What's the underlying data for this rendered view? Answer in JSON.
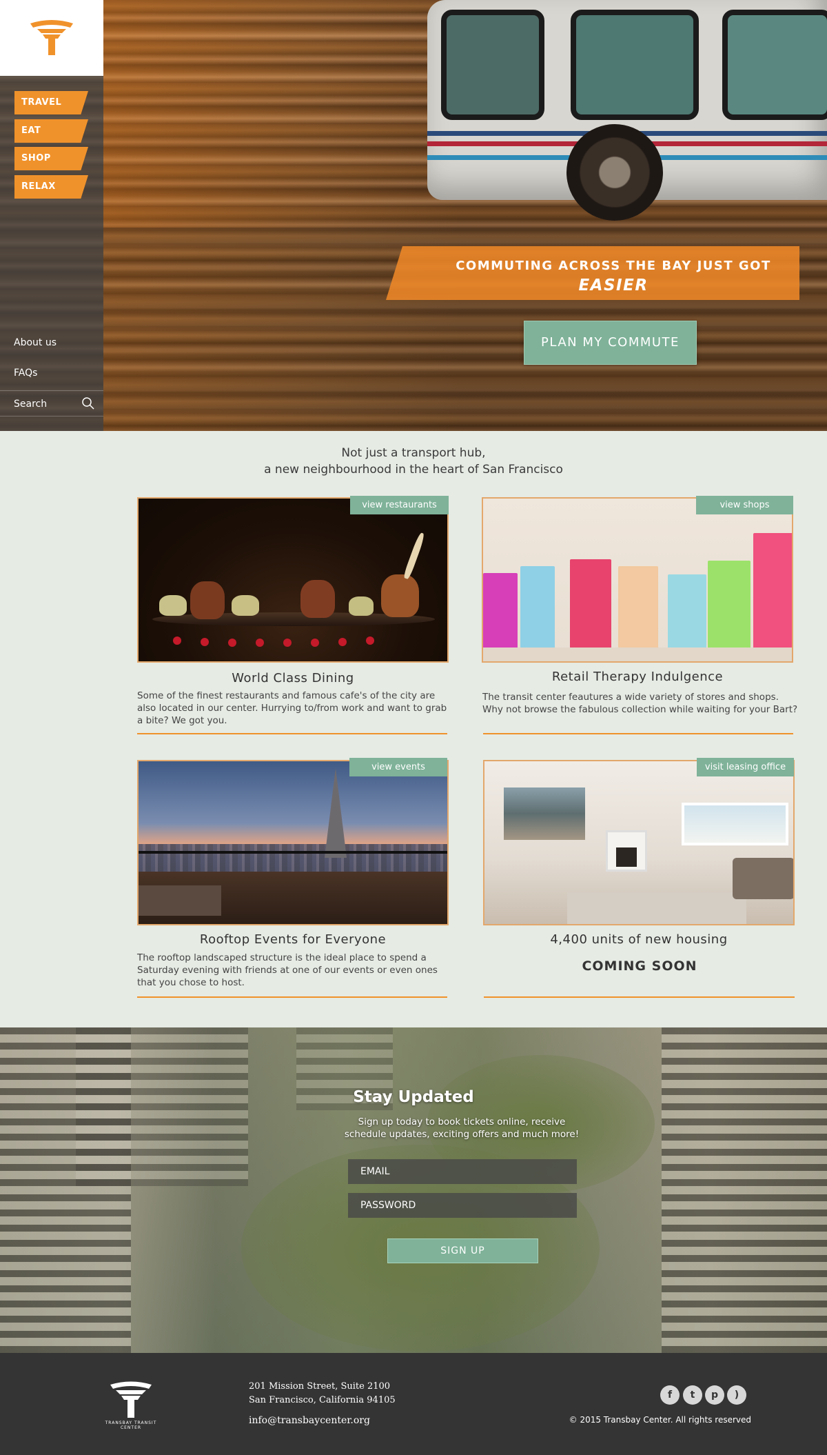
{
  "sidebar": {
    "nav": [
      {
        "label": "TRAVEL"
      },
      {
        "label": "EAT"
      },
      {
        "label": "SHOP"
      },
      {
        "label": "RELAX"
      }
    ],
    "links": [
      {
        "label": "About us"
      },
      {
        "label": "FAQs"
      }
    ],
    "search_label": "Search"
  },
  "hero": {
    "banner_line1": "COMMUTING ACROSS THE BAY JUST GOT",
    "banner_line2": "EASIER",
    "cta_label": "PLAN MY COMMUTE"
  },
  "intro": {
    "line1": "Not just a transport hub,",
    "line2": "a new neighbourhood in the heart of San Francisco"
  },
  "cards": [
    {
      "tag": "view restaurants",
      "title": "World Class Dining",
      "desc": "Some of the finest restaurants and famous cafe's of the city are also located in our center. Hurrying to/from work and want to grab a bite? We got you."
    },
    {
      "tag": "view shops",
      "title": "Retail Therapy Indulgence",
      "desc": "The transit center feautures a wide variety of stores and shops. Why not browse the fabulous collection while waiting for your Bart?"
    },
    {
      "tag": "view events",
      "title": "Rooftop Events for Everyone",
      "desc": "The rooftop landscaped structure is the ideal place to spend a Saturday evening with friends at one of our events or even ones that you chose to host."
    },
    {
      "tag": "visit leasing office",
      "title": "4,400 units of new housing",
      "desc": "COMING SOON"
    }
  ],
  "updates": {
    "title": "Stay Updated",
    "subtitle": "Sign up today to book tickets online, receive schedule updates, exciting offers and much more!",
    "email_placeholder": "EMAIL",
    "password_placeholder": "PASSWORD",
    "button_label": "SIGN UP"
  },
  "footer": {
    "logo_text": "TRANSBAY TRANSIT CENTER",
    "address_line1": "201 Mission Street, Suite 2100",
    "address_line2": "San Francisco, California 94105",
    "email": "info@transbaycenter.org",
    "social": [
      {
        "icon": "facebook-icon",
        "glyph": "f"
      },
      {
        "icon": "twitter-icon",
        "glyph": "t"
      },
      {
        "icon": "pinterest-icon",
        "glyph": "p"
      },
      {
        "icon": "rss-icon",
        "glyph": ")"
      }
    ],
    "copyright": "© 2015 Transbay Center. All rights reserved"
  },
  "colors": {
    "accent_orange": "#f0922b",
    "accent_green": "#7fb299",
    "background": "#e6ebe4",
    "footer": "#343434"
  }
}
